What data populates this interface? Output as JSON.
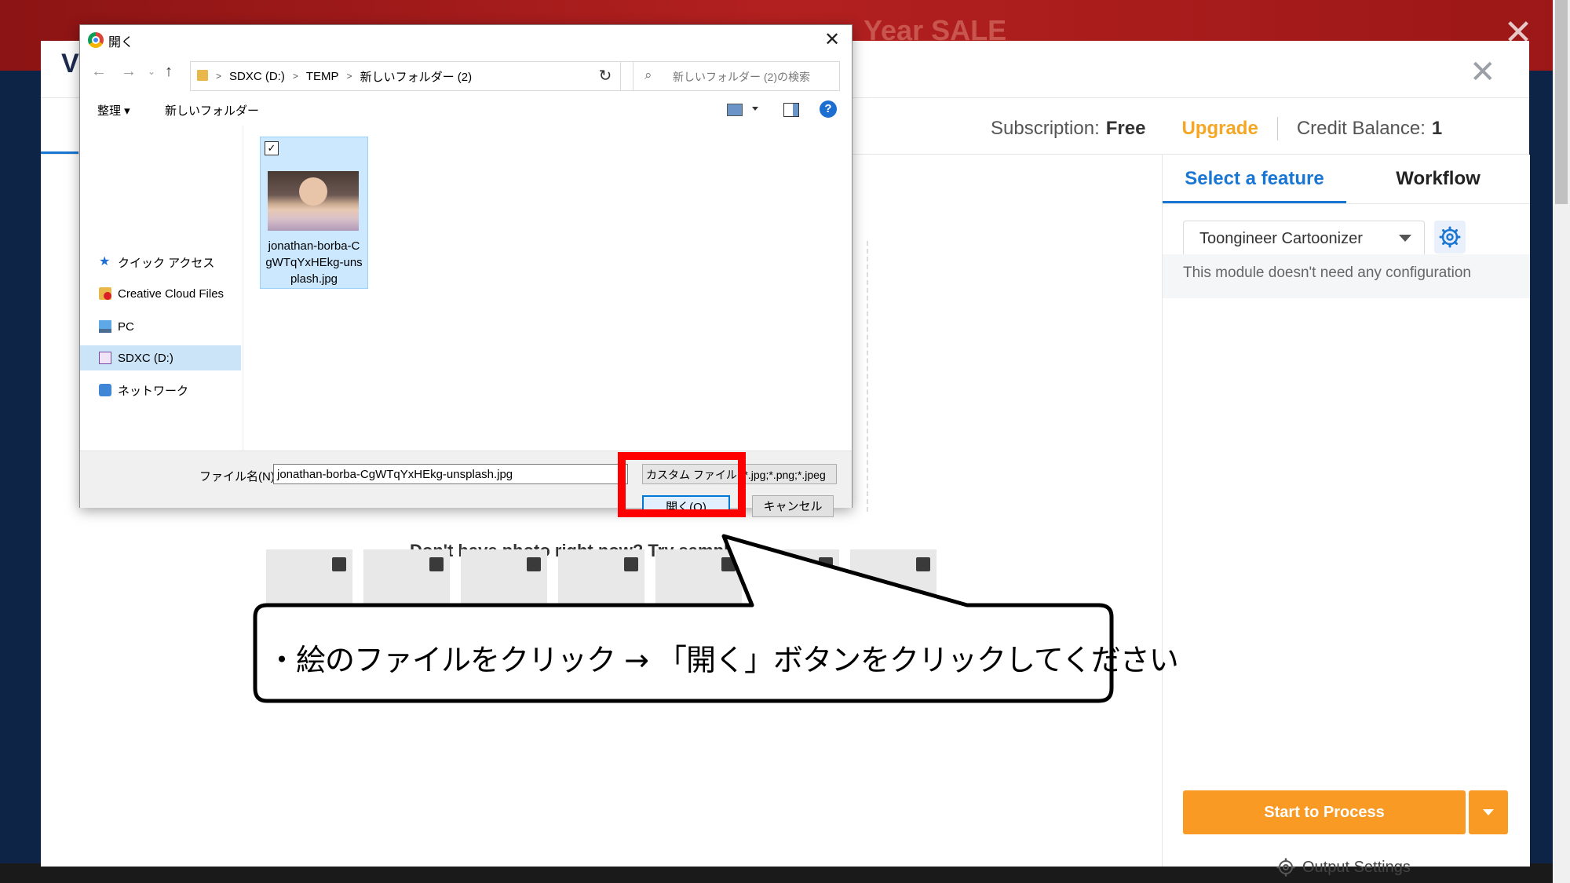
{
  "background": {
    "banner_text": "Year SALE",
    "close_symbol": "✕"
  },
  "app": {
    "title": "V",
    "close_symbol": "✕",
    "header": {
      "subscription_label": "Subscription:",
      "subscription_value": "Free",
      "upgrade_label": "Upgrade",
      "credit_label": "Credit Balance:",
      "credit_value": "1"
    },
    "right_panel": {
      "tabs": [
        {
          "label": "Select a feature",
          "active": true
        },
        {
          "label": "Workflow",
          "active": false
        }
      ],
      "feature_select_value": "Toongineer Cartoonizer",
      "module_note": "This module doesn't need any configuration",
      "process_button": "Start to Process",
      "output_settings": "Output Settings"
    },
    "samples_title": "Don't have photo right now? Try samples"
  },
  "dialog": {
    "title": "開く",
    "close_symbol": "✕",
    "nav": {
      "back": "←",
      "forward": "→",
      "recent": "⌄",
      "up": "↑"
    },
    "breadcrumbs": [
      "SDXC (D:)",
      "TEMP",
      "新しいフォルダー (2)"
    ],
    "breadcrumb_sep": ">",
    "address_dropdown": "⌄",
    "refresh_symbol": "↻",
    "search_placeholder": "新しいフォルダー (2)の検索",
    "toolbar": {
      "organize": "整理 ▾",
      "new_folder": "新しいフォルダー",
      "help": "?"
    },
    "nav_items": [
      {
        "label": "クイック アクセス",
        "icon": "star-icon"
      },
      {
        "label": "Creative Cloud Files",
        "icon": "creative-cloud-icon"
      },
      {
        "label": "PC",
        "icon": "pc-icon"
      },
      {
        "label": "SDXC (D:)",
        "icon": "sd-card-icon",
        "selected": true
      },
      {
        "label": "ネットワーク",
        "icon": "network-icon"
      }
    ],
    "file": {
      "name": "jonathan-borba-CgWTqYxHEkg-unsplash.jpg",
      "checked": true,
      "check_mark": "✓"
    },
    "filename_label": "ファイル名(N):",
    "filename_value": "jonathan-borba-CgWTqYxHEkg-unsplash.jpg",
    "filetype_value": "カスタム ファイル (*.jpg;*.png;*.jpeg",
    "open_button": "開く(O)",
    "cancel_button": "キャンセル"
  },
  "callout": {
    "text": "・絵のファイルをクリック → 「開く」ボタンをクリックしてください"
  },
  "colors": {
    "accent_blue": "#1976d2",
    "orange": "#f99a24",
    "upgrade_orange": "#f5a623",
    "highlight_red": "#ff0000"
  }
}
